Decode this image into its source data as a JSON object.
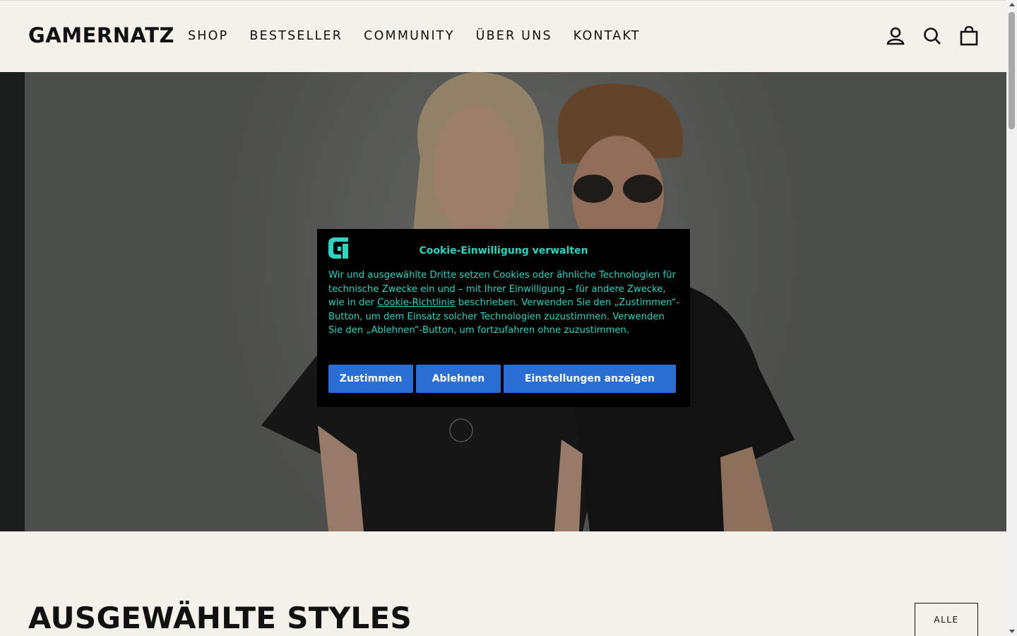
{
  "header": {
    "logo": "GAMERNATZ",
    "nav": [
      "SHOP",
      "BESTSELLER",
      "COMMUNITY",
      "ÜBER UNS",
      "KONTAKT"
    ],
    "icons": [
      "account-icon",
      "search-icon",
      "cart-icon"
    ]
  },
  "cookie": {
    "title": "Cookie-Einwilligung verwalten",
    "text_before_link": "Wir und ausgewählte Dritte setzen Cookies oder ähnliche Technologien für technische Zwecke ein und – mit Ihrer Einwilligung – für andere Zwecke, wie in der ",
    "link": "Cookie-Richtlinie",
    "text_after_link": " beschrieben. Verwenden Sie den „Zustimmen“-Button, um dem Einsatz solcher Technologien zuzustimmen. Verwenden Sie den „Ablehnen“-Button, um fortzufahren ohne zuzustimmen.",
    "buttons": {
      "accept": "Zustimmen",
      "reject": "Ablehnen",
      "settings": "Einstellungen anzeigen"
    },
    "accent_color": "#2fd3c1",
    "button_color": "#2a6dd3"
  },
  "section": {
    "title": "AUSGEWÄHLTE STYLES",
    "all_button": "ALLE"
  }
}
